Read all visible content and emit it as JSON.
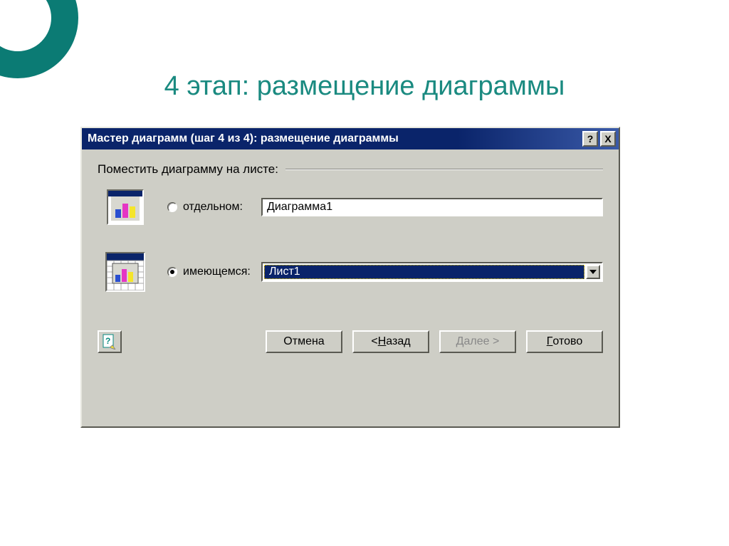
{
  "slide_title": "4 этап: размещение диаграммы",
  "dialog": {
    "title": "Мастер диаграмм (шаг 4 из 4): размещение диаграммы",
    "help_btn": "?",
    "close_btn": "X",
    "group_label": "Поместить диаграмму на листе:",
    "option_new": {
      "label": "отдельном:",
      "value": "Диаграмма1",
      "checked": false
    },
    "option_exist": {
      "label": "имеющемся:",
      "value": "Лист1",
      "checked": true
    },
    "buttons": {
      "cancel": "Отмена",
      "back_prefix": "< ",
      "back_u": "Н",
      "back_rest": "азад",
      "next_prefix": "Далее >",
      "finish_u": "Г",
      "finish_rest": "отово"
    }
  }
}
